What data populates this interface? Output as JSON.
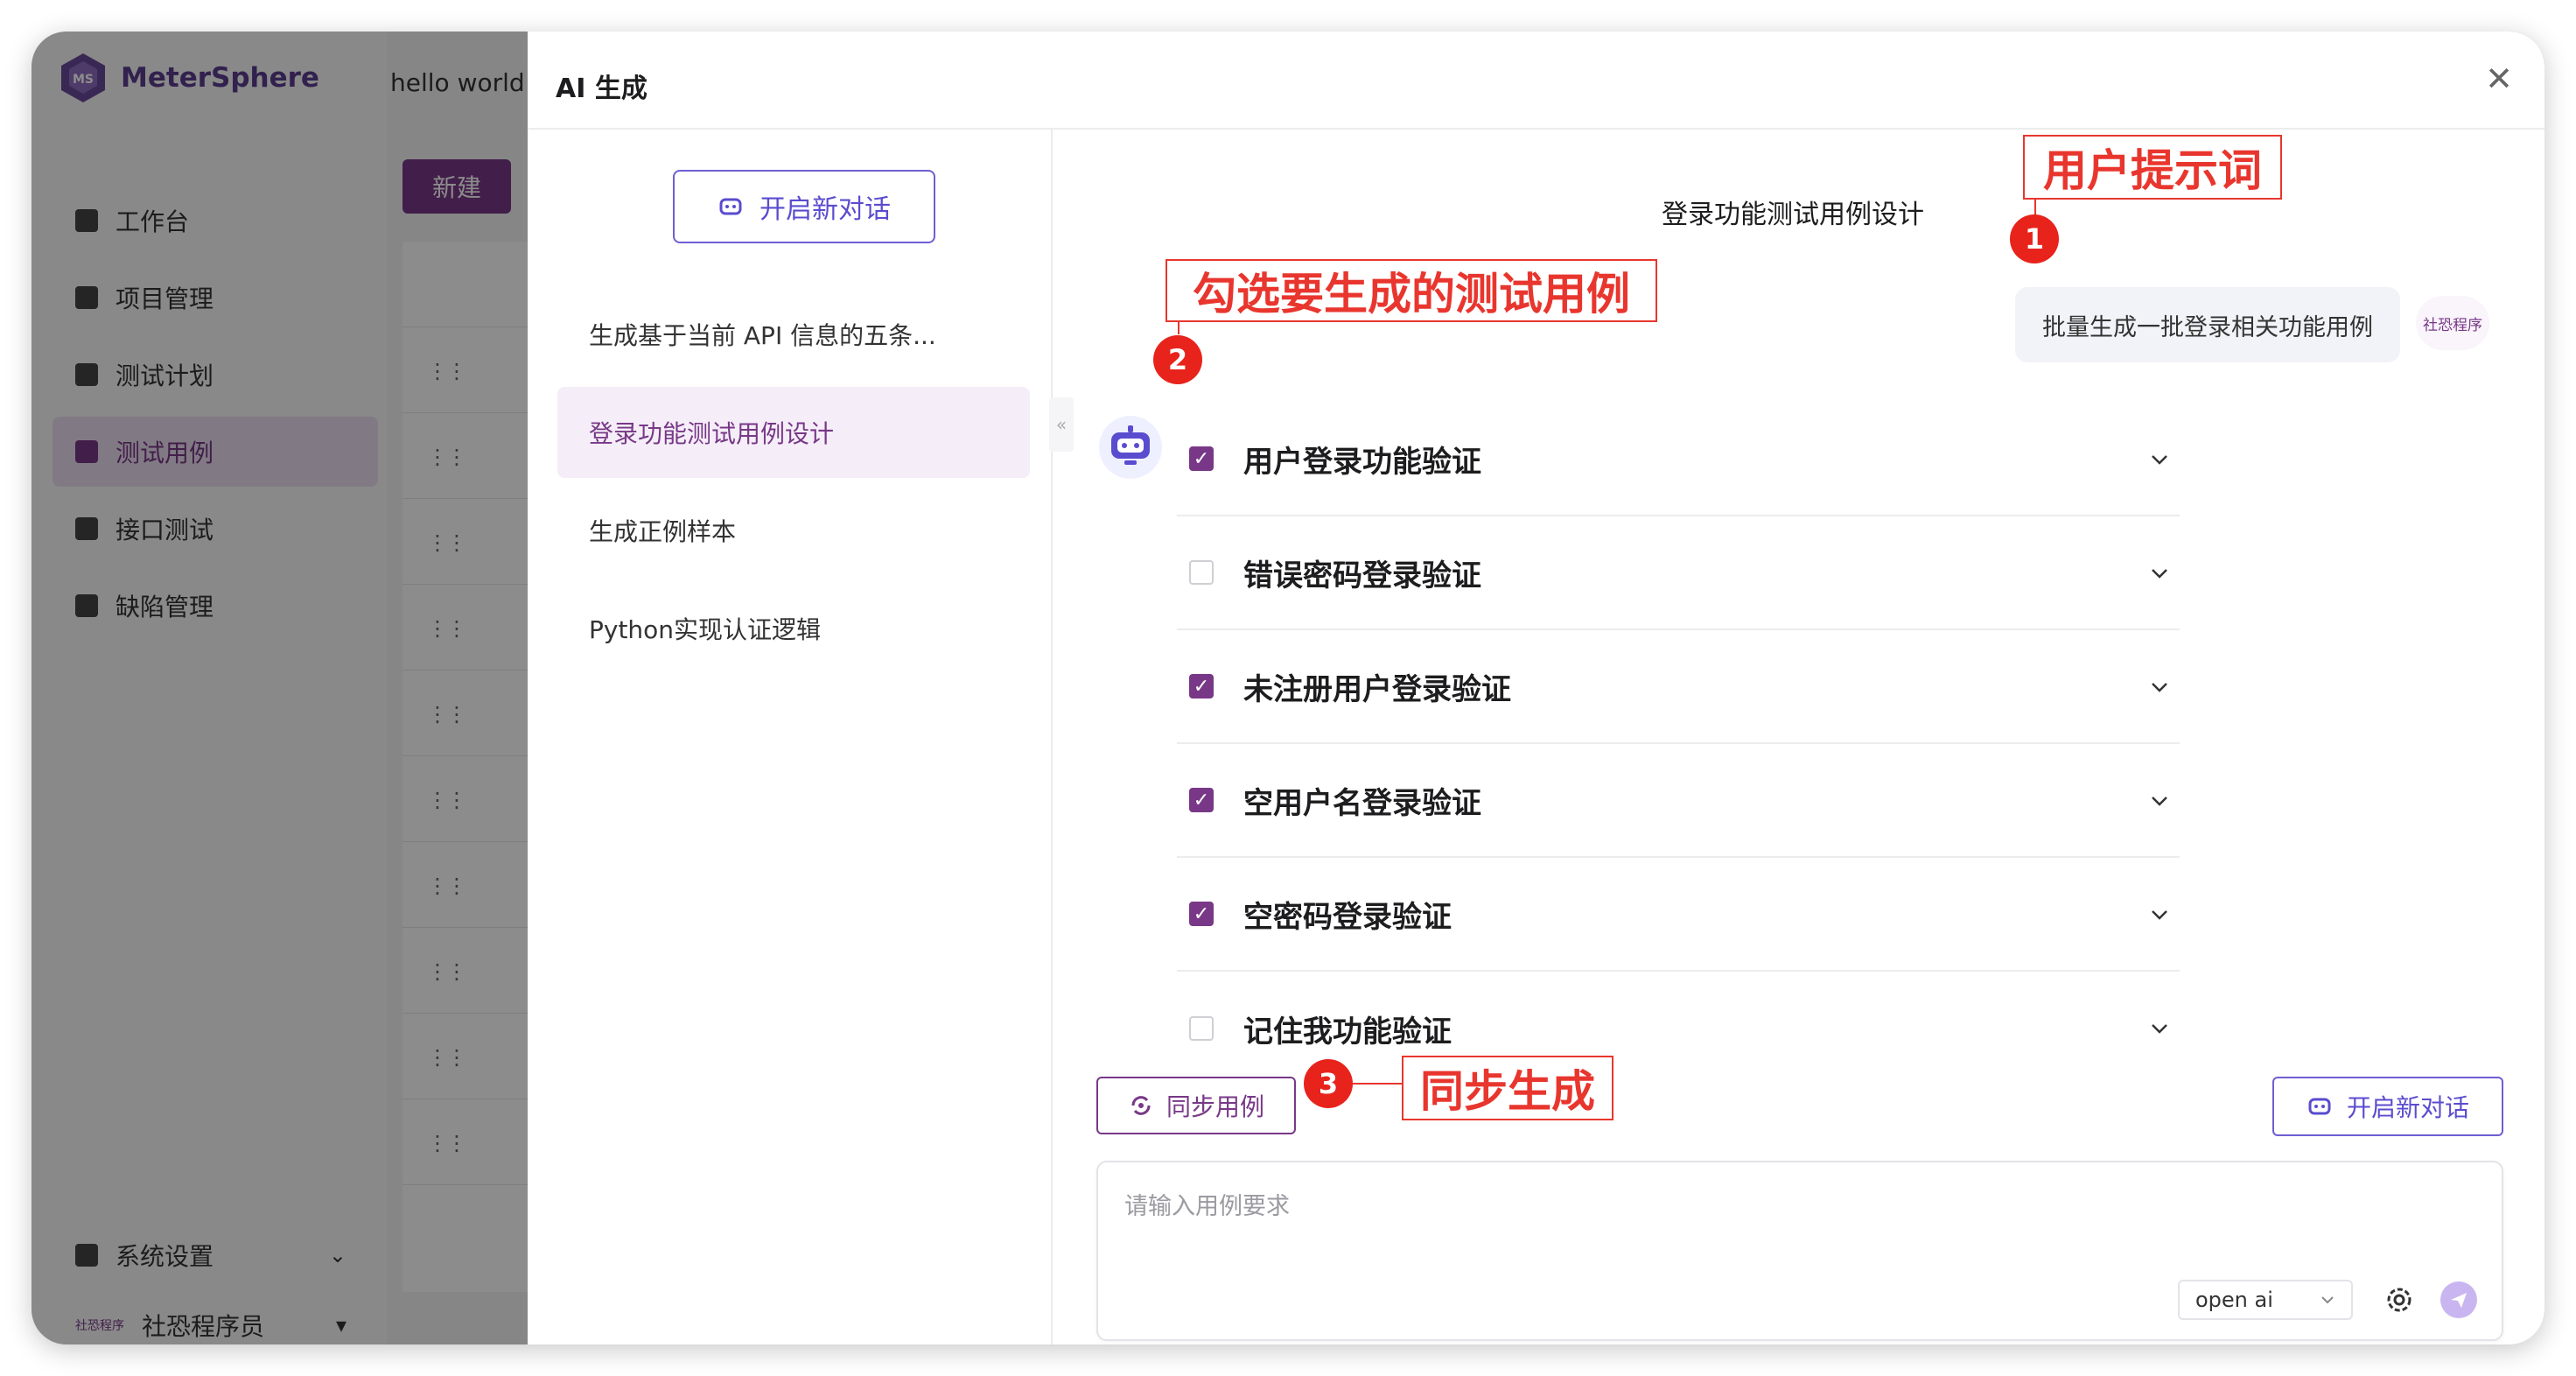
{
  "app": {
    "logo_text": "MeterSphere",
    "header_text": "hello world",
    "new_button": "新建",
    "nav": [
      {
        "label": "工作台",
        "icon": "dashboard-icon"
      },
      {
        "label": "项目管理",
        "icon": "folder-icon"
      },
      {
        "label": "测试计划",
        "icon": "plan-icon"
      },
      {
        "label": "测试用例",
        "icon": "testcase-icon",
        "active": true
      },
      {
        "label": "接口测试",
        "icon": "api-icon"
      },
      {
        "label": "缺陷管理",
        "icon": "bug-icon"
      }
    ],
    "system_settings": "系统设置",
    "user_name": "社恐程序员",
    "user_avatar_text": "社恐程序"
  },
  "drawer": {
    "title": "AI 生成",
    "new_conversation": "开启新对话",
    "history": [
      {
        "label": "生成基于当前 API 信息的五条..."
      },
      {
        "label": "登录功能测试用例设计",
        "active": true
      },
      {
        "label": "生成正例样本"
      },
      {
        "label": "Python实现认证逻辑"
      }
    ],
    "conversation_title": "登录功能测试用例设计",
    "user_message": "批量生成一批登录相关功能用例",
    "user_avatar_text": "社恐程序",
    "cases": [
      {
        "label": "用户登录功能验证",
        "checked": true
      },
      {
        "label": "错误密码登录验证",
        "checked": false
      },
      {
        "label": "未注册用户登录验证",
        "checked": true
      },
      {
        "label": "空用户名登录验证",
        "checked": true
      },
      {
        "label": "空密码登录验证",
        "checked": true
      },
      {
        "label": "记住我功能验证",
        "checked": false
      }
    ],
    "sync_button": "同步用例",
    "new_conversation_bottom": "开启新对话",
    "input_placeholder": "请输入用例要求",
    "model_value": "open ai"
  },
  "annotations": {
    "a1": {
      "number": "1",
      "text": "用户提示词"
    },
    "a2": {
      "number": "2",
      "text": "勾选要生成的测试用例"
    },
    "a3": {
      "number": "3",
      "text": "同步生成"
    }
  },
  "colors": {
    "brand": "#783887",
    "accent": "#5a4ccf",
    "annotation": "#e8362e"
  }
}
